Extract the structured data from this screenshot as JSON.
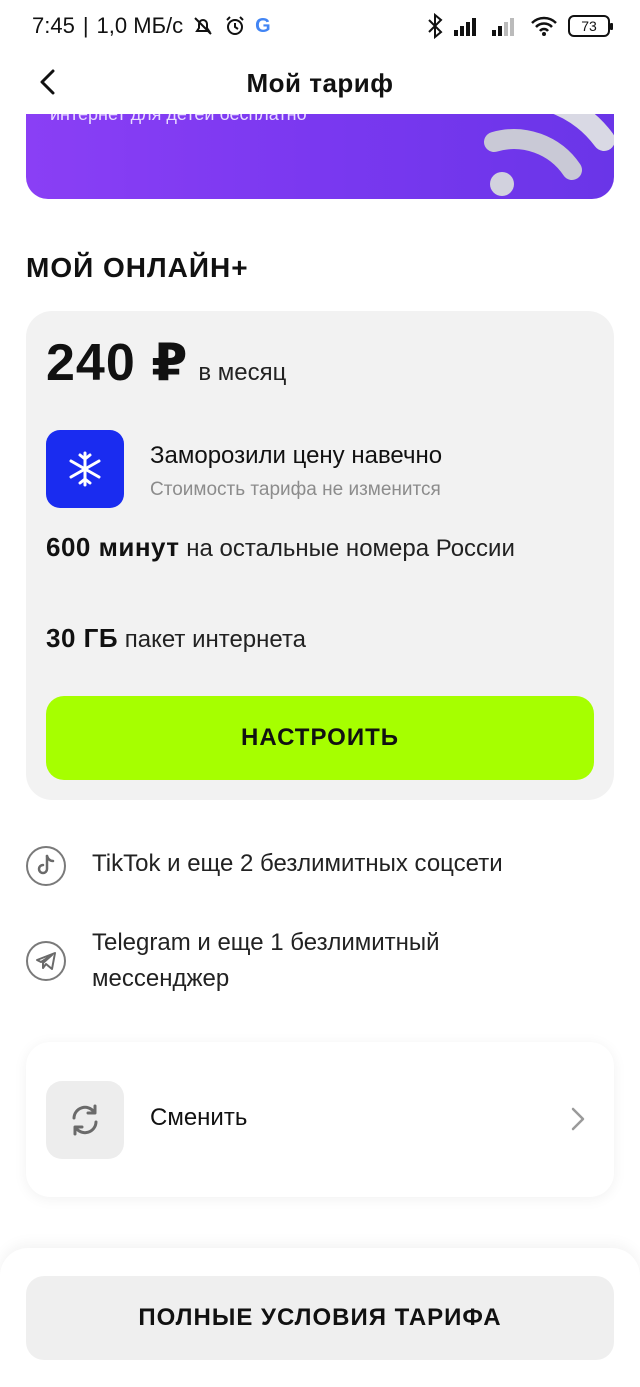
{
  "status_bar": {
    "time": "7:45",
    "separator": "|",
    "net_speed": "1,0 МБ/с",
    "google_letter": "G",
    "battery": "73",
    "icons": [
      "muted-bell-icon",
      "alarm-icon",
      "google-icon",
      "bluetooth-icon",
      "signal-icon",
      "signal-weak-icon",
      "wifi-icon",
      "battery-icon"
    ]
  },
  "header": {
    "title": "Мой тариф",
    "back_icon": "chevron-left-icon"
  },
  "banner": {
    "text": "интернет для детей бесплатно",
    "art_icon": "wifi-3d-icon",
    "color": "#7a38f0"
  },
  "tariff": {
    "name": "МОЙ ОНЛАЙН+",
    "price": "240 ₽",
    "period": "в месяц",
    "freeze": {
      "icon": "snowflake-icon",
      "title": "Заморозили цену навечно",
      "subtitle": "Стоимость тарифа не изменится",
      "color": "#1a2cf0"
    },
    "minutes": {
      "value": "600 минут",
      "description": "на остальные номера России"
    },
    "internet": {
      "value": "30 ГБ",
      "description": "пакет интернета"
    },
    "configure_button": "НАСТРОИТЬ",
    "accent": "#a6ff00"
  },
  "perks": [
    {
      "icon": "tiktok-icon",
      "text": "TikTok и еще 2 безлимитных соцсети"
    },
    {
      "icon": "telegram-icon",
      "text": "Telegram и еще 1 безлимитный мессенджер"
    }
  ],
  "change": {
    "icon": "refresh-icon",
    "label": "Сменить",
    "chevron": "chevron-right-icon"
  },
  "bottom": {
    "terms_button": "ПОЛНЫЕ УСЛОВИЯ ТАРИФА"
  }
}
